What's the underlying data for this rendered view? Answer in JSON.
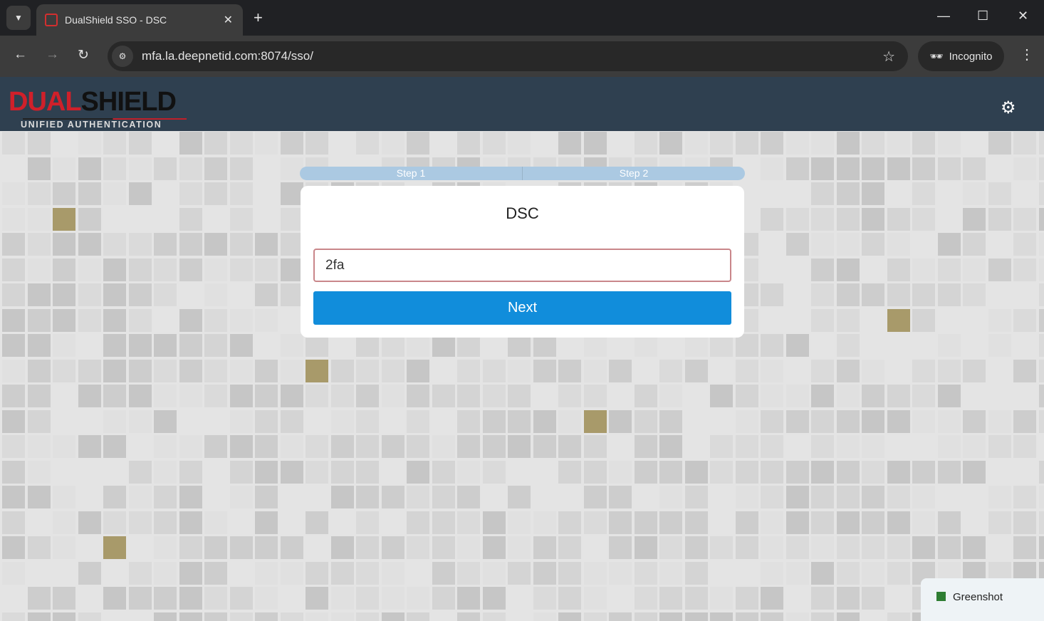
{
  "browser": {
    "tab_title": "DualShield SSO - DSC",
    "url": "mfa.la.deepnetid.com:8074/sso/",
    "incognito_label": "Incognito"
  },
  "logo": {
    "dual": "DUAL",
    "shield": "SHIELD",
    "tagline": "UNIFIED AUTHENTICATION"
  },
  "steps": [
    "Step 1",
    "Step 2"
  ],
  "card": {
    "title": "DSC",
    "input_value": "2fa",
    "next_label": "Next"
  },
  "taskbar": {
    "toast_label": "Greenshot"
  },
  "colors": {
    "header": "#2f4050",
    "button": "#118ddb",
    "steps": "#abc9e2"
  }
}
